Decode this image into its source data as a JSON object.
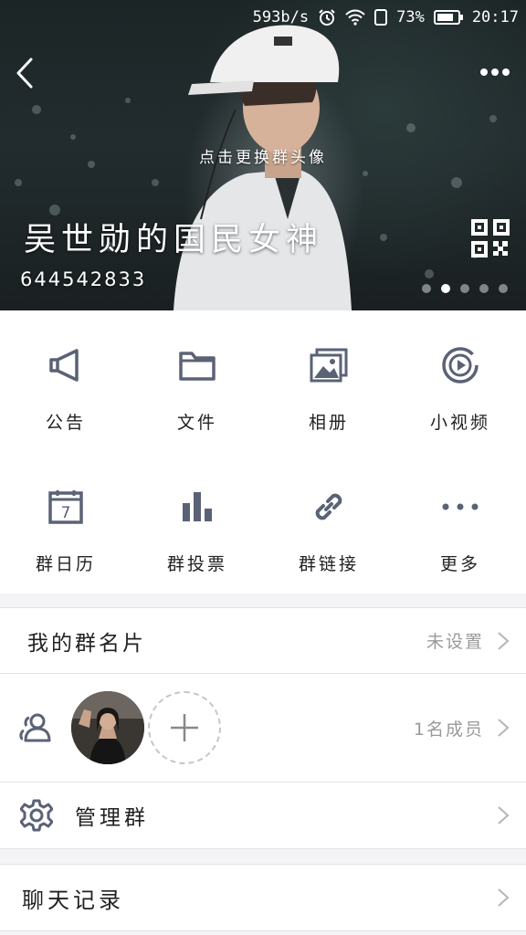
{
  "status_bar": {
    "speed": "593b/s",
    "battery": "73%",
    "time": "20:17"
  },
  "header": {
    "change_avatar_hint": "点击更换群头像",
    "group_name": "吴世勋的国民女神",
    "group_id": "644542833",
    "pager": {
      "count": 5,
      "active_index": 1
    }
  },
  "features": [
    {
      "label": "公告",
      "icon": "megaphone-icon"
    },
    {
      "label": "文件",
      "icon": "folder-icon"
    },
    {
      "label": "相册",
      "icon": "photo-album-icon"
    },
    {
      "label": "小视频",
      "icon": "video-play-icon"
    },
    {
      "label": "群日历",
      "icon": "calendar-icon"
    },
    {
      "label": "群投票",
      "icon": "bar-chart-icon"
    },
    {
      "label": "群链接",
      "icon": "link-icon"
    },
    {
      "label": "更多",
      "icon": "more-dots-icon"
    }
  ],
  "calendar_day": "7",
  "group_card": {
    "title": "我的群名片",
    "value": "未设置"
  },
  "members": {
    "count_label": "1名成员"
  },
  "manage": {
    "title": "管理群"
  },
  "history": {
    "title": "聊天记录"
  },
  "colors": {
    "icon": "#5a6275",
    "accent_text": "#222222",
    "secondary_text": "#9a9a9a"
  }
}
